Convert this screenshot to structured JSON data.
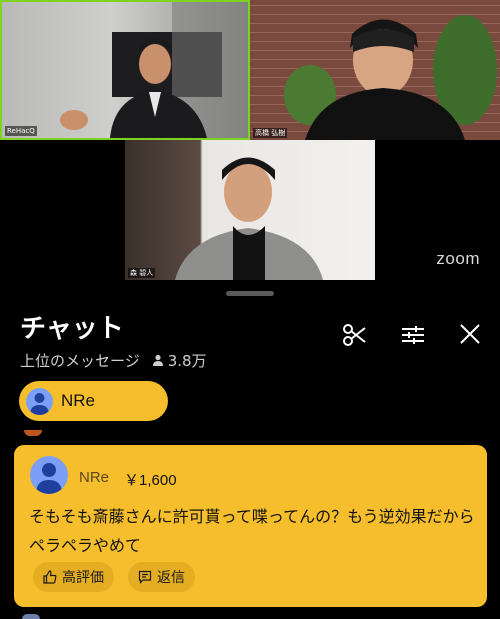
{
  "video": {
    "participants": [
      {
        "name": "ReHacQ"
      },
      {
        "name": "高橋 弘樹"
      },
      {
        "name": "森 碧人"
      }
    ],
    "watermark": "zoom"
  },
  "chat": {
    "title": "チャット",
    "filter_label": "上位のメッセージ",
    "viewer_count": "3.8万",
    "header_icons": [
      "scissors-icon",
      "sliders-icon",
      "close-icon"
    ]
  },
  "pinned": {
    "name": "NRe"
  },
  "superchat": {
    "name": "NRe",
    "amount": "￥1,600",
    "message": "そもそも斎藤さんに許可貰って喋ってんの？もう逆効果だからペラペラやめて",
    "like_label": "高評価",
    "reply_label": "返信",
    "color": "#f6be2c"
  }
}
